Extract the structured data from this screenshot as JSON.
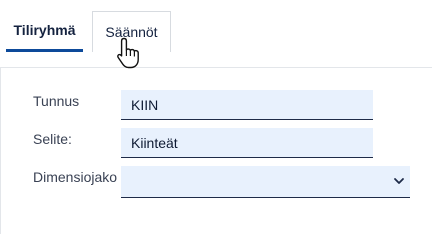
{
  "tabs": [
    {
      "label": "Tiliryhmä",
      "active": true
    },
    {
      "label": "Säännöt",
      "active": false
    }
  ],
  "form": {
    "tunnus": {
      "label": "Tunnus",
      "value": "KIIN"
    },
    "selite": {
      "label": "Selite:",
      "value": "Kiinteät"
    },
    "dimensiojako": {
      "label": "Dimensiojako",
      "value": ""
    }
  },
  "icons": {
    "cursor": "hand-pointer-icon",
    "select_arrow": "chevron-down-icon"
  },
  "colors": {
    "accent": "#0d4a9a",
    "field_bg": "#e8f1fd",
    "text": "#14223f"
  }
}
